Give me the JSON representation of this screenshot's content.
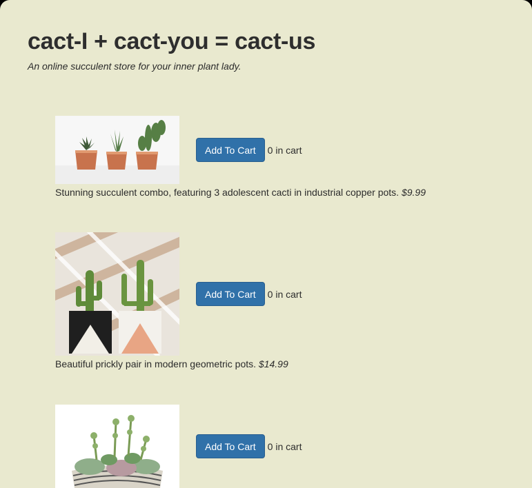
{
  "header": {
    "title": "cact-I + cact-you = cact-us",
    "tagline": "An online succulent store for your inner plant lady."
  },
  "products": [
    {
      "description": "Stunning succulent combo, featuring 3 adolescent cacti in industrial copper pots.",
      "price": "$9.99",
      "button_label": "Add To Cart",
      "cart_count": "0 in cart"
    },
    {
      "description": "Beautiful prickly pair in modern geometric pots.",
      "price": "$14.99",
      "button_label": "Add To Cart",
      "cart_count": "0 in cart"
    },
    {
      "button_label": "Add To Cart",
      "cart_count": "0 in cart"
    }
  ],
  "colors": {
    "page_background": "#e9e9cf",
    "button_background": "#3071a9",
    "button_border": "#285e8e",
    "text": "#2b2b2b"
  }
}
